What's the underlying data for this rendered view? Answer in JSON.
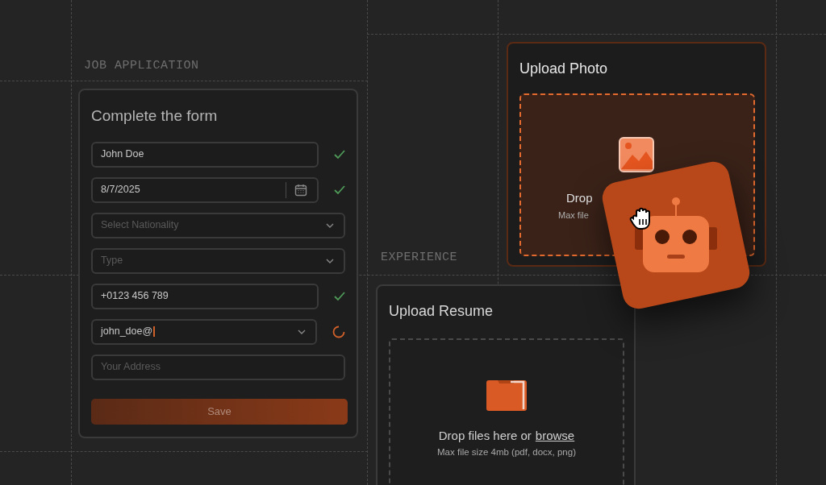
{
  "sections": [
    {
      "label": "JOB APPLICATION"
    },
    {
      "label": "EXPERIENCE"
    }
  ],
  "form": {
    "title": "Complete the form",
    "fields": [
      {
        "kind": "text",
        "value": "John Doe",
        "valid": true,
        "loading": false
      },
      {
        "kind": "date",
        "value": "8/7/2025",
        "valid": true,
        "loading": false
      },
      {
        "kind": "select",
        "placeholder": "Select Nationality",
        "valid": false,
        "loading": false
      },
      {
        "kind": "select",
        "placeholder": "Type",
        "valid": false,
        "loading": false
      },
      {
        "kind": "text",
        "value": "+0123 456 789",
        "valid": true,
        "loading": false
      },
      {
        "kind": "combo",
        "value": "john_doe@",
        "valid": false,
        "loading": true
      },
      {
        "kind": "text",
        "placeholder": "Your Address",
        "valid": false,
        "loading": false
      }
    ],
    "save_button": "Save"
  },
  "upload_photo": {
    "title": "Upload Photo",
    "drop_text": "Drop",
    "hint": "Max file"
  },
  "upload_resume": {
    "title": "Upload Resume",
    "drop_text": "Drop files here or",
    "browse_link": "browse",
    "hint": "Max file size 4mb (pdf, docx, png)"
  }
}
